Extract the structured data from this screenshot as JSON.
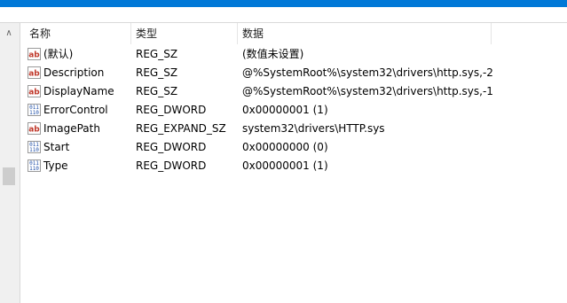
{
  "columns": {
    "name": "名称",
    "type": "类型",
    "data": "数据"
  },
  "rows": [
    {
      "icon": "string-value-icon",
      "name": "(默认)",
      "type": "REG_SZ",
      "data": "(数值未设置)"
    },
    {
      "icon": "string-value-icon",
      "name": "Description",
      "type": "REG_SZ",
      "data": "@%SystemRoot%\\system32\\drivers\\http.sys,-2"
    },
    {
      "icon": "string-value-icon",
      "name": "DisplayName",
      "type": "REG_SZ",
      "data": "@%SystemRoot%\\system32\\drivers\\http.sys,-1"
    },
    {
      "icon": "binary-value-icon",
      "name": "ErrorControl",
      "type": "REG_DWORD",
      "data": "0x00000001 (1)"
    },
    {
      "icon": "string-value-icon",
      "name": "ImagePath",
      "type": "REG_EXPAND_SZ",
      "data": "system32\\drivers\\HTTP.sys"
    },
    {
      "icon": "binary-value-icon",
      "name": "Start",
      "type": "REG_DWORD",
      "data": "0x00000000 (0)"
    },
    {
      "icon": "binary-value-icon",
      "name": "Type",
      "type": "REG_DWORD",
      "data": "0x00000001 (1)"
    }
  ],
  "colors": {
    "titlebar": "#0078d7",
    "string_icon": "#c0392b",
    "binary_icon": "#1f4fa8"
  }
}
